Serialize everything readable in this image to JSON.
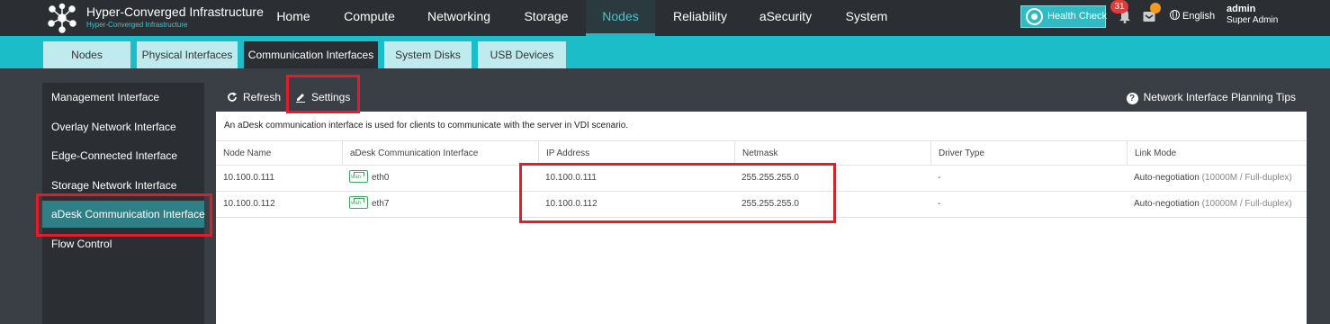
{
  "app": {
    "title": "Hyper-Converged Infrastructure",
    "subtitle": "Hyper-Converged Infrastructure"
  },
  "nav": {
    "items": [
      "Home",
      "Compute",
      "Networking",
      "Storage",
      "Nodes",
      "Reliability",
      "aSecurity",
      "System"
    ],
    "active": "Nodes"
  },
  "header": {
    "health_check": "Health Check",
    "alert_count": "31",
    "language": "English",
    "user_name": "admin",
    "user_role": "Super Admin"
  },
  "subtabs": {
    "items": [
      "Nodes",
      "Physical Interfaces",
      "Communication Interfaces",
      "System Disks",
      "USB Devices"
    ],
    "active": "Communication Interfaces"
  },
  "sidebar": {
    "items": [
      "Management Interface",
      "Overlay Network Interface",
      "Edge-Connected Interface",
      "Storage Network Interface",
      "aDesk Communication Interface",
      "Flow Control"
    ],
    "active": "aDesk Communication Interface"
  },
  "toolbar": {
    "refresh": "Refresh",
    "settings": "Settings",
    "tips": "Network Interface Planning Tips"
  },
  "info": "An aDesk communication interface is used for clients to communicate with the server in VDI scenario.",
  "table": {
    "headers": [
      "Node Name",
      "aDesk Communication Interface",
      "IP Address",
      "Netmask",
      "Driver Type",
      "Link Mode"
    ],
    "rows": [
      {
        "node": "10.100.0.111",
        "iface": "eth0",
        "ip": "10.100.0.111",
        "netmask": "255.255.255.0",
        "driver": "-",
        "link_mode": "Auto-negotiation",
        "link_detail": "(10000M / Full-duplex)"
      },
      {
        "node": "10.100.0.112",
        "iface": "eth7",
        "ip": "10.100.0.112",
        "netmask": "255.255.255.0",
        "driver": "-",
        "link_mode": "Auto-negotiation",
        "link_detail": "(10000M / Full-duplex)"
      }
    ]
  },
  "colors": {
    "accent": "#1bbec8",
    "highlight": "#e01d2a",
    "topbar": "#2b2f33"
  }
}
